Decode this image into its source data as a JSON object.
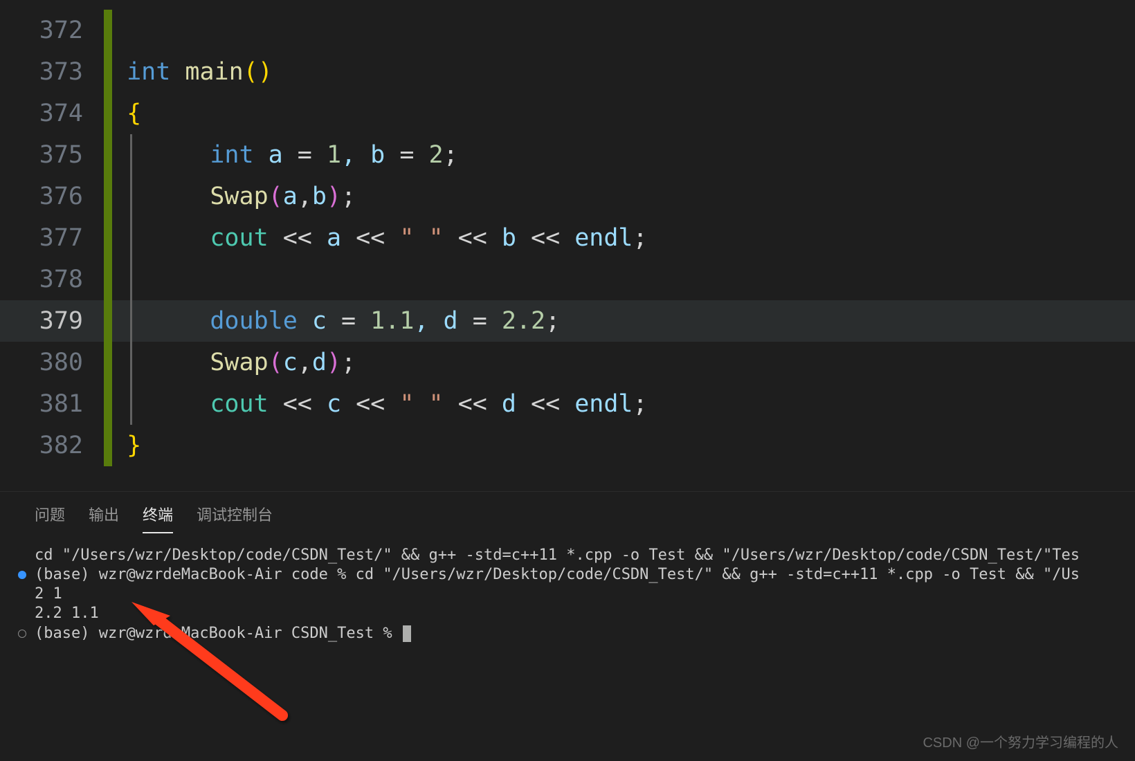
{
  "code": {
    "lines": [
      {
        "num": "372",
        "active": false,
        "indent": false,
        "hl": false,
        "tokens": []
      },
      {
        "num": "373",
        "active": false,
        "indent": false,
        "hl": false,
        "tokens": [
          {
            "t": " ",
            "c": "txt"
          },
          {
            "t": "int",
            "c": "kw"
          },
          {
            "t": " ",
            "c": "txt"
          },
          {
            "t": "main",
            "c": "fn"
          },
          {
            "t": "(",
            "c": "br-y"
          },
          {
            "t": ")",
            "c": "br-y"
          }
        ]
      },
      {
        "num": "374",
        "active": false,
        "indent": false,
        "hl": false,
        "tokens": [
          {
            "t": " ",
            "c": "txt"
          },
          {
            "t": "{",
            "c": "br-y"
          }
        ]
      },
      {
        "num": "375",
        "active": false,
        "indent": true,
        "hl": false,
        "tokens": [
          {
            "t": "     ",
            "c": "txt"
          },
          {
            "t": "int",
            "c": "kw"
          },
          {
            "t": " a ",
            "c": "id"
          },
          {
            "t": "=",
            "c": "op"
          },
          {
            "t": " ",
            "c": "txt"
          },
          {
            "t": "1",
            "c": "nm"
          },
          {
            "t": ", b ",
            "c": "id"
          },
          {
            "t": "=",
            "c": "op"
          },
          {
            "t": " ",
            "c": "txt"
          },
          {
            "t": "2",
            "c": "nm"
          },
          {
            "t": ";",
            "c": "pn"
          }
        ]
      },
      {
        "num": "376",
        "active": false,
        "indent": true,
        "hl": false,
        "tokens": [
          {
            "t": "     ",
            "c": "txt"
          },
          {
            "t": "Swap",
            "c": "fn"
          },
          {
            "t": "(",
            "c": "br-p"
          },
          {
            "t": "a",
            "c": "id"
          },
          {
            "t": ",",
            "c": "pn"
          },
          {
            "t": "b",
            "c": "id"
          },
          {
            "t": ")",
            "c": "br-p"
          },
          {
            "t": ";",
            "c": "pn"
          }
        ]
      },
      {
        "num": "377",
        "active": false,
        "indent": true,
        "hl": false,
        "tokens": [
          {
            "t": "     ",
            "c": "txt"
          },
          {
            "t": "cout",
            "c": "obj"
          },
          {
            "t": " << ",
            "c": "op"
          },
          {
            "t": "a",
            "c": "id"
          },
          {
            "t": " << ",
            "c": "op"
          },
          {
            "t": "\" \"",
            "c": "str"
          },
          {
            "t": " << ",
            "c": "op"
          },
          {
            "t": "b",
            "c": "id"
          },
          {
            "t": " << ",
            "c": "op"
          },
          {
            "t": "endl",
            "c": "id"
          },
          {
            "t": ";",
            "c": "pn"
          }
        ]
      },
      {
        "num": "378",
        "active": false,
        "indent": true,
        "hl": false,
        "tokens": []
      },
      {
        "num": "379",
        "active": true,
        "indent": true,
        "hl": true,
        "tokens": [
          {
            "t": "     ",
            "c": "txt"
          },
          {
            "t": "double",
            "c": "kw"
          },
          {
            "t": " c ",
            "c": "id"
          },
          {
            "t": "=",
            "c": "op"
          },
          {
            "t": " ",
            "c": "txt"
          },
          {
            "t": "1.1",
            "c": "nm"
          },
          {
            "t": ", d ",
            "c": "id"
          },
          {
            "t": "=",
            "c": "op"
          },
          {
            "t": " ",
            "c": "txt"
          },
          {
            "t": "2.2",
            "c": "nm"
          },
          {
            "t": ";",
            "c": "pn"
          }
        ]
      },
      {
        "num": "380",
        "active": false,
        "indent": true,
        "hl": false,
        "tokens": [
          {
            "t": "     ",
            "c": "txt"
          },
          {
            "t": "Swap",
            "c": "fn"
          },
          {
            "t": "(",
            "c": "br-p"
          },
          {
            "t": "c",
            "c": "id"
          },
          {
            "t": ",",
            "c": "pn"
          },
          {
            "t": "d",
            "c": "id"
          },
          {
            "t": ")",
            "c": "br-p"
          },
          {
            "t": ";",
            "c": "pn"
          }
        ]
      },
      {
        "num": "381",
        "active": false,
        "indent": true,
        "hl": false,
        "tokens": [
          {
            "t": "     ",
            "c": "txt"
          },
          {
            "t": "cout",
            "c": "obj"
          },
          {
            "t": " << ",
            "c": "op"
          },
          {
            "t": "c",
            "c": "id"
          },
          {
            "t": " << ",
            "c": "op"
          },
          {
            "t": "\" \"",
            "c": "str"
          },
          {
            "t": " << ",
            "c": "op"
          },
          {
            "t": "d",
            "c": "id"
          },
          {
            "t": " << ",
            "c": "op"
          },
          {
            "t": "endl",
            "c": "id"
          },
          {
            "t": ";",
            "c": "pn"
          }
        ]
      },
      {
        "num": "382",
        "active": false,
        "indent": false,
        "hl": false,
        "tokens": [
          {
            "t": " ",
            "c": "txt"
          },
          {
            "t": "}",
            "c": "br-y"
          }
        ]
      }
    ]
  },
  "panel": {
    "tabs": [
      {
        "label": "问题",
        "active": false
      },
      {
        "label": "输出",
        "active": false
      },
      {
        "label": "终端",
        "active": true
      },
      {
        "label": "调试控制台",
        "active": false
      }
    ],
    "terminal_rows": [
      {
        "marker": "",
        "text": "cd \"/Users/wzr/Desktop/code/CSDN_Test/\" && g++ -std=c++11 *.cpp -o Test && \"/Users/wzr/Desktop/code/CSDN_Test/\"Tes"
      },
      {
        "marker": "dot",
        "text": "(base) wzr@wzrdeMacBook-Air code % cd \"/Users/wzr/Desktop/code/CSDN_Test/\" && g++ -std=c++11 *.cpp -o Test && \"/Us"
      },
      {
        "marker": "",
        "text": "2 1"
      },
      {
        "marker": "",
        "text": "2.2 1.1"
      },
      {
        "marker": "ring",
        "text": "(base) wzr@wzrdeMacBook-Air CSDN_Test % ",
        "cursor": true
      }
    ]
  },
  "watermark": "CSDN @一个努力学习编程的人"
}
